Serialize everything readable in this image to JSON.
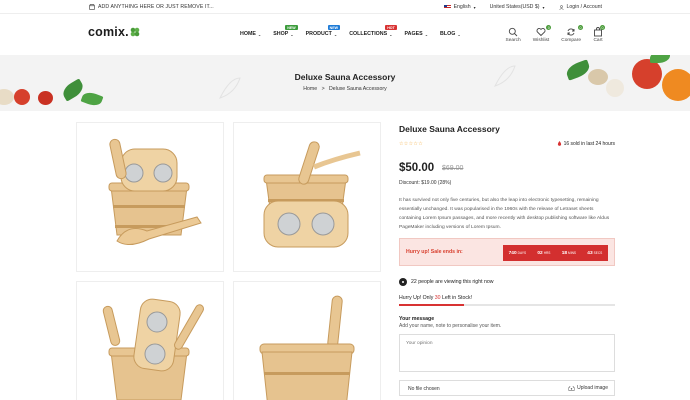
{
  "topbar": {
    "announcement": "ADD ANYTHING HERE OR JUST REMOVE IT...",
    "language": "English",
    "currency": "United States(USD $)",
    "account": "Login / Account"
  },
  "header": {
    "logo": "comix.",
    "nav": [
      {
        "label": "HOME",
        "badge": ""
      },
      {
        "label": "SHOP",
        "badge": "NEW"
      },
      {
        "label": "PRODUCT",
        "badge": "NEW"
      },
      {
        "label": "COLLECTIONS",
        "badge": "HOT"
      },
      {
        "label": "PAGES",
        "badge": ""
      },
      {
        "label": "BLOG",
        "badge": ""
      }
    ],
    "icons": [
      {
        "label": "Search",
        "icon": "search-icon",
        "count": ""
      },
      {
        "label": "Wishlist",
        "icon": "heart-icon",
        "count": "0"
      },
      {
        "label": "Compare",
        "icon": "refresh-icon",
        "count": "0"
      },
      {
        "label": "Cart",
        "icon": "bag-icon",
        "count": "0"
      }
    ]
  },
  "hero": {
    "title": "Deluxe Sauna Accessory",
    "crumb_home": "Home",
    "crumb_sep": ">",
    "crumb_current": "Deluxe Sauna Accessory"
  },
  "product": {
    "title": "Deluxe Sauna Accessory",
    "rating": 0,
    "sold_text": "16 sold in last 24 hours",
    "price": "$50.00",
    "old_price": "$69.00",
    "discount": "Discount: $19.00 (28%)",
    "description": "It has survived not only five centuries, but also the leap into electronic typesetting, remaining essentially unchanged. It was popularised in the 1960s with the release of Letraset sheets containing Lorem Ipsum passages, and more recently with desktop publishing software like Aldus PageMaker including versions of Lorem Ipsum.",
    "sale": {
      "label": "Hurry up! Sale ends in:",
      "days": "740",
      "days_label": "DAYS",
      "hrs": "02",
      "hrs_label": "HRS",
      "mins": "18",
      "mins_label": "MINS",
      "secs": "43",
      "secs_label": "SECS"
    },
    "viewing": "22 people are viewing this right now",
    "stock_prefix": "Hurry Up! Only",
    "stock_count": "30",
    "stock_suffix": "Left in Stock!",
    "stock_fraction": 0.3,
    "message_title": "Your message",
    "message_sub": "Add your name, note to personalise your item.",
    "opinion_placeholder": "Your opinion",
    "file_chosen": "No file chosen",
    "upload_label": "Upload image"
  },
  "colors": {
    "accent_red": "#d83232",
    "green": "#4a9b3a",
    "star": "#f2a32a"
  }
}
